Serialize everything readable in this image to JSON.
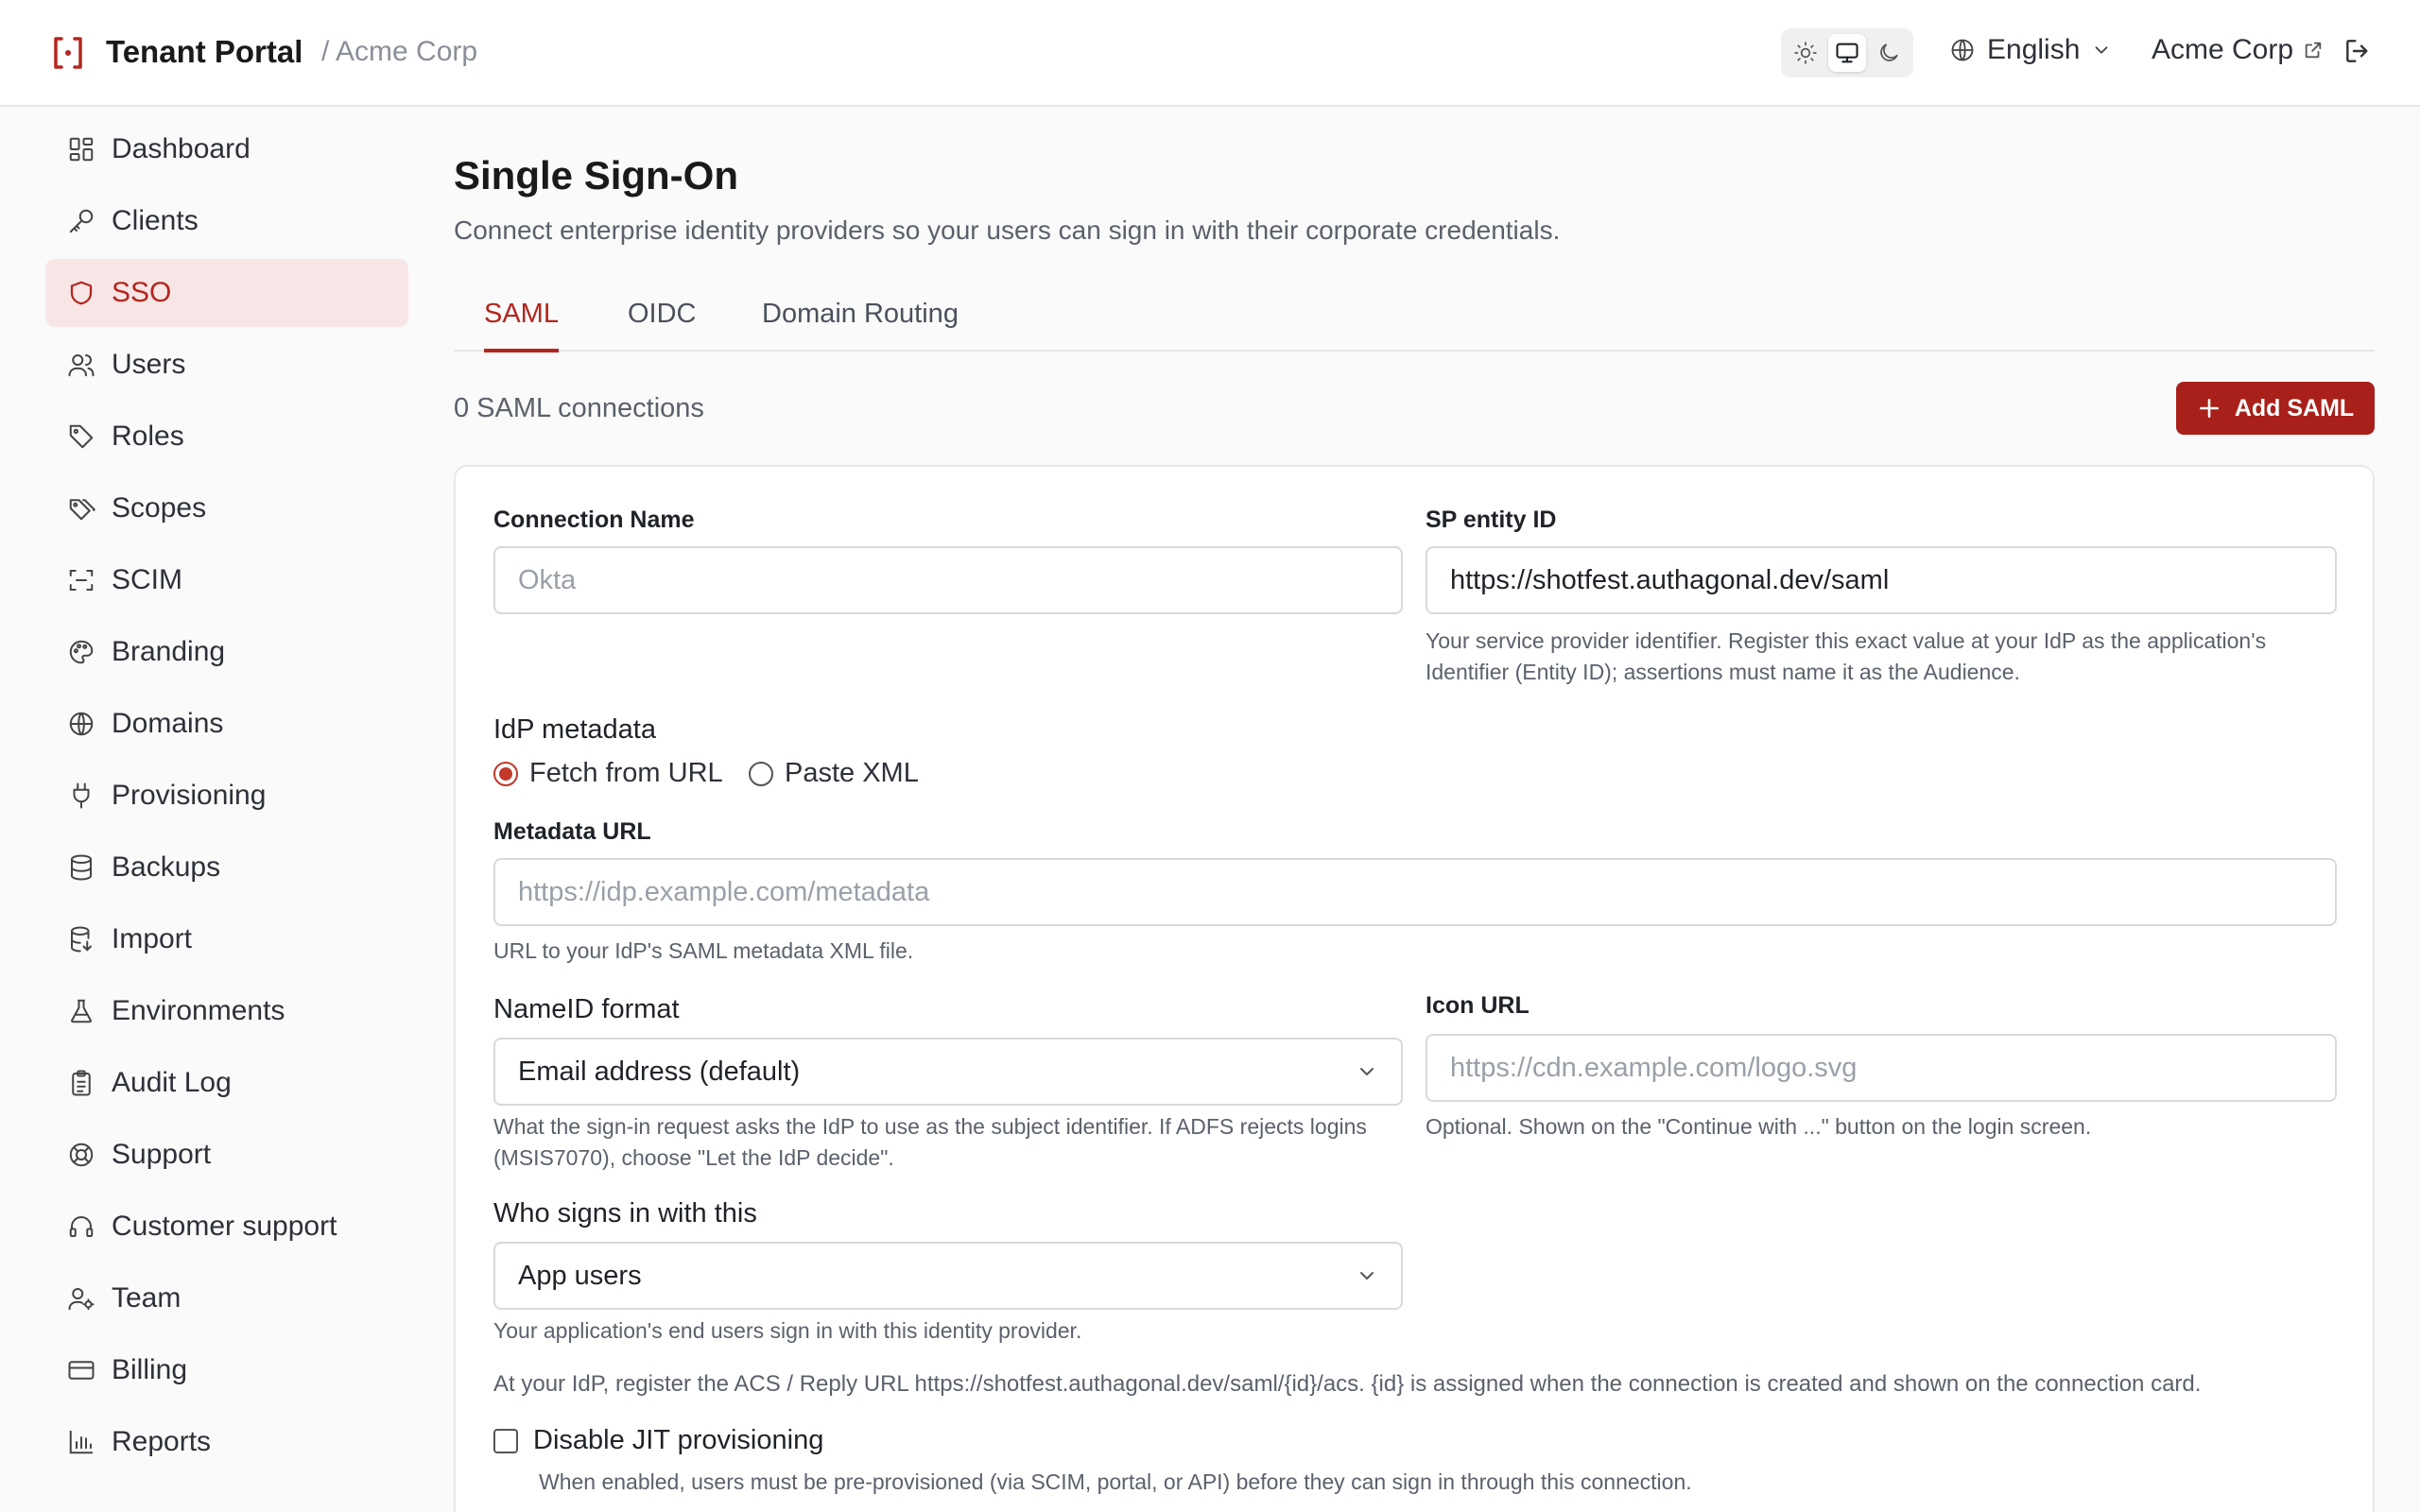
{
  "header": {
    "app_title": "Tenant Portal",
    "breadcrumb": "/ Acme Corp",
    "theme_icons": [
      "sun-icon",
      "monitor-icon",
      "moon-icon"
    ],
    "theme_selected": "system",
    "language": "English",
    "tenant_link": "Acme Corp",
    "accent_color": "#b3261e"
  },
  "sidebar": {
    "items": [
      {
        "label": "Dashboard",
        "icon": "dashboard-icon"
      },
      {
        "label": "Clients",
        "icon": "key-icon"
      },
      {
        "label": "SSO",
        "icon": "shield-icon",
        "active": true
      },
      {
        "label": "Users",
        "icon": "users-icon"
      },
      {
        "label": "Roles",
        "icon": "tag-icon"
      },
      {
        "label": "Scopes",
        "icon": "tags-icon"
      },
      {
        "label": "SCIM",
        "icon": "scan-icon"
      },
      {
        "label": "Branding",
        "icon": "palette-icon"
      },
      {
        "label": "Domains",
        "icon": "globe-icon"
      },
      {
        "label": "Provisioning",
        "icon": "plug-icon"
      },
      {
        "label": "Backups",
        "icon": "database-icon"
      },
      {
        "label": "Import",
        "icon": "database-import-icon"
      },
      {
        "label": "Environments",
        "icon": "flask-icon"
      },
      {
        "label": "Audit Log",
        "icon": "clipboard-icon"
      },
      {
        "label": "Support",
        "icon": "lifebuoy-icon"
      },
      {
        "label": "Customer support",
        "icon": "headset-icon"
      },
      {
        "label": "Team",
        "icon": "user-cog-icon"
      },
      {
        "label": "Billing",
        "icon": "credit-card-icon"
      },
      {
        "label": "Reports",
        "icon": "bar-chart-icon"
      }
    ]
  },
  "main": {
    "title": "Single Sign-On",
    "subtitle": "Connect enterprise identity providers so your users can sign in with their corporate credentials.",
    "tabs": [
      {
        "label": "SAML",
        "active": true
      },
      {
        "label": "OIDC"
      },
      {
        "label": "Domain Routing"
      }
    ],
    "connection_count": "0 SAML connections",
    "add_button": "Add SAML",
    "form": {
      "connection_name_label": "Connection Name",
      "connection_name_placeholder": "Okta",
      "sp_entity_label": "SP entity ID",
      "sp_entity_value": "https://shotfest.authagonal.dev/saml",
      "sp_entity_help": "Your service provider identifier. Register this exact value at your IdP as the application's Identifier (Entity ID); assertions must name it as the Audience.",
      "idp_metadata_label": "IdP metadata",
      "radio_fetch": "Fetch from URL",
      "radio_paste": "Paste XML",
      "radio_selected": "Fetch from URL",
      "metadata_url_label": "Metadata URL",
      "metadata_url_placeholder": "https://idp.example.com/metadata",
      "metadata_url_help": "URL to your IdP's SAML metadata XML file.",
      "nameid_label": "NameID format",
      "nameid_value": "Email address (default)",
      "nameid_help": "What the sign-in request asks the IdP to use as the subject identifier. If ADFS rejects logins (MSIS7070), choose \"Let the IdP decide\".",
      "icon_url_label": "Icon URL",
      "icon_url_placeholder": "https://cdn.example.com/logo.svg",
      "icon_url_help": "Optional. Shown on the \"Continue with ...\" button on the login screen.",
      "who_signs_label": "Who signs in with this",
      "who_signs_value": "App users",
      "who_signs_help": "Your application's end users sign in with this identity provider.",
      "acs_note": "At your IdP, register the ACS / Reply URL https://shotfest.authagonal.dev/saml/{id}/acs. {id} is assigned when the connection is created and shown on the connection card.",
      "jit_label": "Disable JIT provisioning",
      "jit_checked": false,
      "jit_help": "When enabled, users must be pre-provisioned (via SCIM, portal, or API) before they can sign in through this connection."
    }
  }
}
